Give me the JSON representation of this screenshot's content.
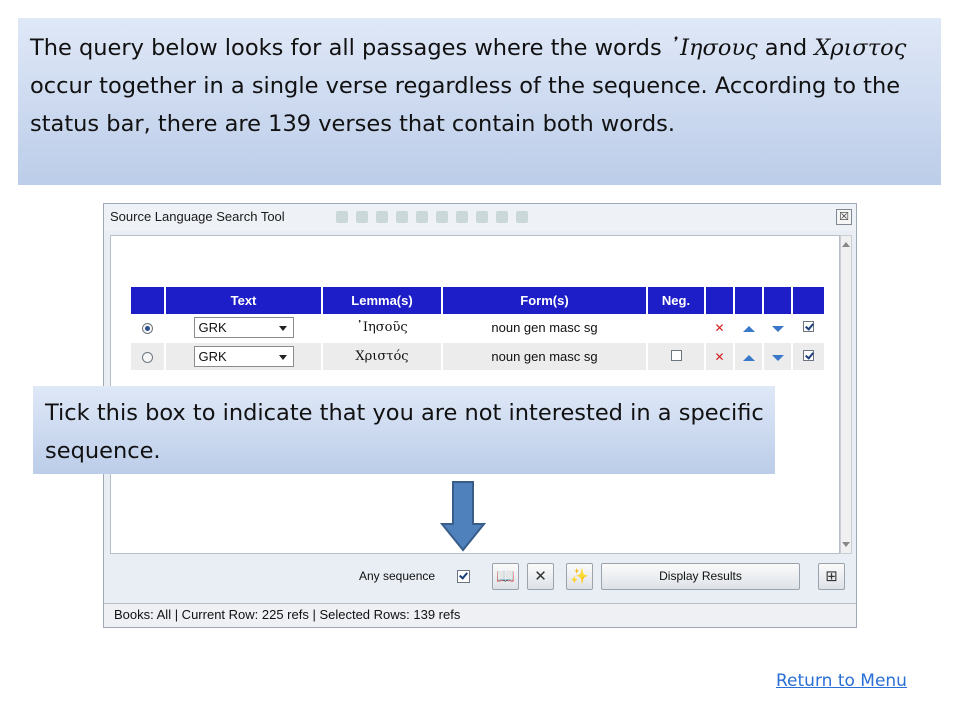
{
  "top_callout": {
    "text_before": "The query below looks for all passages where the words ",
    "greek_word_1": "᾿Ιησους",
    "text_and": " and ",
    "greek_word_2": "Χριστος",
    "text_after": " occur together in a single verse regardless of the sequence. According to the status bar, there are 139 verses that contain both words."
  },
  "window": {
    "title": "Source Language Search Tool",
    "close_label": "☒"
  },
  "grid": {
    "headers": [
      "",
      "Text",
      "Lemma(s)",
      "Form(s)",
      "Neg.",
      "",
      "",
      "",
      ""
    ],
    "rows": [
      {
        "selected": true,
        "text": "GRK",
        "lemma": "᾿Ιησοῦς",
        "form": "noun gen masc sg",
        "neg_shown": false,
        "neg": false,
        "delete_icon": "✕",
        "enabled": true
      },
      {
        "selected": false,
        "text": "GRK",
        "lemma": "Χριστός",
        "form": "noun gen masc sg",
        "neg_shown": true,
        "neg": false,
        "delete_icon": "✕",
        "enabled": true
      }
    ]
  },
  "mid_callout": {
    "text": "Tick this box to indicate that you are not interested in a specific sequence."
  },
  "bottom_bar": {
    "any_sequence_label": "Any sequence",
    "any_sequence_checked": true,
    "display_results_label": "Display Results"
  },
  "status_bar": {
    "text": "Books: All | Current Row: 225 refs | Selected Rows: 139 refs"
  },
  "colors": {
    "header_blue": "#1e1ec8",
    "callout_blue": "#c5d4ee",
    "arrow_blue": "#4f81bd",
    "link_blue": "#2a6fd6"
  },
  "footer": {
    "return_link": "Return to Menu"
  }
}
